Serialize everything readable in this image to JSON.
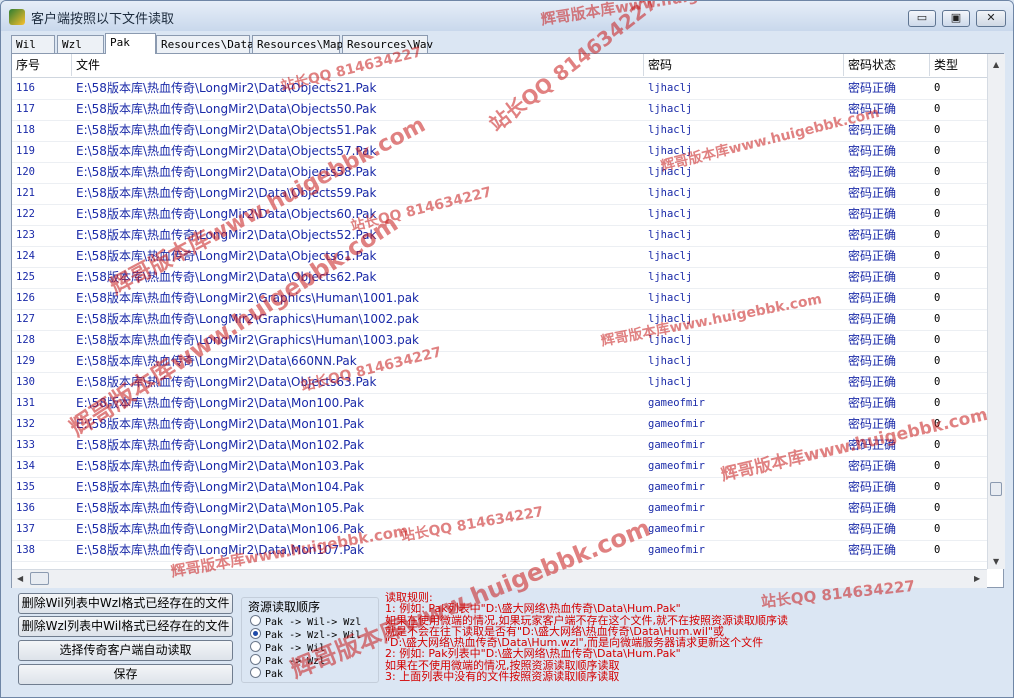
{
  "window": {
    "title": "客户端按照以下文件读取",
    "minimize": "▭",
    "restore": "▣",
    "close": "✕"
  },
  "tabs": [
    "Wil",
    "Wzl",
    "Pak",
    "Resources\\Data",
    "Resources\\Map",
    "Resources\\Wav"
  ],
  "active_tab": 2,
  "table": {
    "headers": [
      "序号",
      "文件",
      "密码",
      "密码状态",
      "类型"
    ],
    "rows": [
      [
        "116",
        "E:\\58版本库\\热血传奇\\LongMir2\\Data\\Objects21.Pak",
        "ljhaclj",
        "密码正确",
        "0"
      ],
      [
        "117",
        "E:\\58版本库\\热血传奇\\LongMir2\\Data\\Objects50.Pak",
        "ljhaclj",
        "密码正确",
        "0"
      ],
      [
        "118",
        "E:\\58版本库\\热血传奇\\LongMir2\\Data\\Objects51.Pak",
        "ljhaclj",
        "密码正确",
        "0"
      ],
      [
        "119",
        "E:\\58版本库\\热血传奇\\LongMir2\\Data\\Objects57.Pak",
        "ljhaclj",
        "密码正确",
        "0"
      ],
      [
        "120",
        "E:\\58版本库\\热血传奇\\LongMir2\\Data\\Objects58.Pak",
        "ljhaclj",
        "密码正确",
        "0"
      ],
      [
        "121",
        "E:\\58版本库\\热血传奇\\LongMir2\\Data\\Objects59.Pak",
        "ljhaclj",
        "密码正确",
        "0"
      ],
      [
        "122",
        "E:\\58版本库\\热血传奇\\LongMir2\\Data\\Objects60.Pak",
        "ljhaclj",
        "密码正确",
        "0"
      ],
      [
        "123",
        "E:\\58版本库\\热血传奇\\LongMir2\\Data\\Objects52.Pak",
        "ljhaclj",
        "密码正确",
        "0"
      ],
      [
        "124",
        "E:\\58版本库\\热血传奇\\LongMir2\\Data\\Objects61.Pak",
        "ljhaclj",
        "密码正确",
        "0"
      ],
      [
        "125",
        "E:\\58版本库\\热血传奇\\LongMir2\\Data\\Objects62.Pak",
        "ljhaclj",
        "密码正确",
        "0"
      ],
      [
        "126",
        "E:\\58版本库\\热血传奇\\LongMir2\\Graphics\\Human\\1001.pak",
        "ljhaclj",
        "密码正确",
        "0"
      ],
      [
        "127",
        "E:\\58版本库\\热血传奇\\LongMir2\\Graphics\\Human\\1002.pak",
        "ljhaclj",
        "密码正确",
        "0"
      ],
      [
        "128",
        "E:\\58版本库\\热血传奇\\LongMir2\\Graphics\\Human\\1003.pak",
        "ljhaclj",
        "密码正确",
        "0"
      ],
      [
        "129",
        "E:\\58版本库\\热血传奇\\LongMir2\\Data\\660NN.Pak",
        "ljhaclj",
        "密码正确",
        "0"
      ],
      [
        "130",
        "E:\\58版本库\\热血传奇\\LongMir2\\Data\\Objects63.Pak",
        "ljhaclj",
        "密码正确",
        "0"
      ],
      [
        "131",
        "E:\\58版本库\\热血传奇\\LongMir2\\Data\\Mon100.Pak",
        "gameofmir",
        "密码正确",
        "0"
      ],
      [
        "132",
        "E:\\58版本库\\热血传奇\\LongMir2\\Data\\Mon101.Pak",
        "gameofmir",
        "密码正确",
        "0"
      ],
      [
        "133",
        "E:\\58版本库\\热血传奇\\LongMir2\\Data\\Mon102.Pak",
        "gameofmir",
        "密码正确",
        "0"
      ],
      [
        "134",
        "E:\\58版本库\\热血传奇\\LongMir2\\Data\\Mon103.Pak",
        "gameofmir",
        "密码正确",
        "0"
      ],
      [
        "135",
        "E:\\58版本库\\热血传奇\\LongMir2\\Data\\Mon104.Pak",
        "gameofmir",
        "密码正确",
        "0"
      ],
      [
        "136",
        "E:\\58版本库\\热血传奇\\LongMir2\\Data\\Mon105.Pak",
        "gameofmir",
        "密码正确",
        "0"
      ],
      [
        "137",
        "E:\\58版本库\\热血传奇\\LongMir2\\Data\\Mon106.Pak",
        "gameofmir",
        "密码正确",
        "0"
      ],
      [
        "138",
        "E:\\58版本库\\热血传奇\\LongMir2\\Data\\Mon107.Pak",
        "gameofmir",
        "密码正确",
        "0"
      ]
    ]
  },
  "buttons": {
    "delete_wil": "删除Wil列表中Wzl格式已经存在的文件",
    "delete_wzl": "删除Wzl列表中Wil格式已经存在的文件",
    "select_client": "选择传奇客户端自动读取",
    "save": "保存"
  },
  "order_group": {
    "title": "资源读取顺序",
    "options": [
      "Pak -> Wil-> Wzl",
      "Pak -> Wzl-> Wil",
      "Pak -> Wil",
      "Pak -> Wzl",
      "Pak"
    ],
    "selected": 1
  },
  "rules": {
    "title": "读取规则:",
    "lines": [
      "1: 例如: Pak列表中\"D:\\盛大网络\\热血传奇\\Data\\Hum.Pak\"",
      "   如果在使用微端的情况,如果玩家客户端不存在这个文件,就不在按照资源读取顺序读",
      "   就是不会在往下读取是否有\"D:\\盛大网络\\热血传奇\\Data\\Hum.wil\"或",
      "  \"D:\\盛大网络\\热血传奇\\Data\\Hum.wzl\",而是向微端服务器请求更新这个文件",
      "2: 例如: Pak列表中\"D:\\盛大网络\\热血传奇\\Data\\Hum.Pak\"",
      "   如果在不使用微端的情况,按照资源读取顺序读取",
      "3: 上面列表中没有的文件按照资源读取顺序读取"
    ]
  },
  "watermarks": {
    "site": "辉哥版本库www.huigebbk.com",
    "qq": "站长QQ 814634227"
  },
  "colors": {
    "link_blue": "#1a2aa8",
    "rule_red": "#d40000",
    "watermark_red": "#c81b1b",
    "window_bg": "#dbe6f3"
  }
}
